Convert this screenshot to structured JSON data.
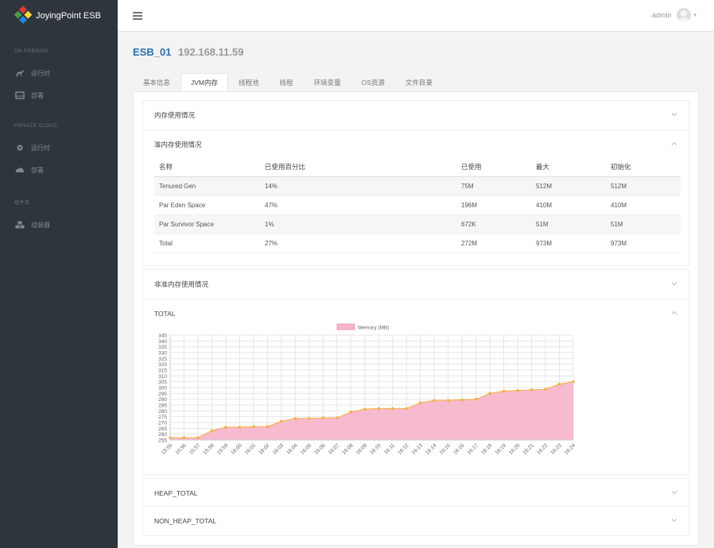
{
  "app": {
    "name": "JoyingPoint ESB"
  },
  "sidebar": {
    "sections": [
      {
        "title": "ON PREMISE",
        "items": [
          {
            "label": "运行时"
          },
          {
            "label": "部署"
          }
        ]
      },
      {
        "title": "PRIVATE CLOUD",
        "items": [
          {
            "label": "运行时"
          },
          {
            "label": "部署"
          }
        ]
      },
      {
        "title": "组件库",
        "items": [
          {
            "label": "组装器"
          }
        ]
      }
    ]
  },
  "header": {
    "user": "admin"
  },
  "page": {
    "name": "ESB_01",
    "ip": "192.168.11.59"
  },
  "tabs": [
    {
      "label": "基本信息"
    },
    {
      "label": "JVM内存"
    },
    {
      "label": "线程池"
    },
    {
      "label": "线程"
    },
    {
      "label": "环境变量"
    },
    {
      "label": "OS资源"
    },
    {
      "label": "文件目录"
    }
  ],
  "panels": {
    "memory_usage": {
      "title": "内存使用情况"
    },
    "heap": {
      "title": "准内存使用情况",
      "columns": [
        "名称",
        "已使用百分比",
        "已使用",
        "最大",
        "初始化"
      ],
      "rows": [
        [
          "Tenured Gen",
          "14%",
          "75M",
          "512M",
          "512M"
        ],
        [
          "Par Eden Space",
          "47%",
          "196M",
          "410M",
          "410M"
        ],
        [
          "Par Survivor Space",
          "1%",
          "672K",
          "51M",
          "51M"
        ],
        [
          "Total",
          "27%",
          "272M",
          "973M",
          "973M"
        ]
      ]
    },
    "nonheap": {
      "title": "非准内存使用情况"
    },
    "total": {
      "title": "TOTAL"
    },
    "heap_total": {
      "title": "HEAP_TOTAL"
    },
    "non_heap_total": {
      "title": "NON_HEAP_TOTAL"
    }
  },
  "chart_data": {
    "type": "area",
    "legend": "Memory (MB)",
    "legend_position": "top-center",
    "grid": true,
    "ylim": [
      255,
      345
    ],
    "yticks": [
      255,
      260,
      265,
      270,
      275,
      280,
      285,
      290,
      295,
      300,
      305,
      310,
      315,
      320,
      325,
      330,
      335,
      340,
      345
    ],
    "x": [
      "15:55",
      "15:56",
      "15:57",
      "15:58",
      "15:59",
      "16:00",
      "16:01",
      "16:02",
      "16:03",
      "16:04",
      "16:05",
      "16:06",
      "16:07",
      "16:08",
      "16:09",
      "16:10",
      "16:11",
      "16:12",
      "16:13",
      "16:14",
      "16:15",
      "16:16",
      "16:17",
      "16:18",
      "16:19",
      "16:20",
      "16:21",
      "16:22",
      "16:23",
      "16:24"
    ],
    "series": [
      {
        "name": "Memory (MB)",
        "values": [
          257,
          257,
          257,
          263,
          266,
          266,
          266.5,
          266.5,
          271,
          273.5,
          273.5,
          274,
          274,
          279,
          281.5,
          282,
          282,
          282,
          287,
          289,
          289,
          289.5,
          290,
          295,
          297,
          297.5,
          298,
          298.5,
          303,
          305
        ],
        "fill": "#f7b6cb",
        "line": "#f5b041"
      }
    ]
  },
  "colors": {
    "sidebar": "#2f353d",
    "accent": "#2a6fb0",
    "area_fill": "#f7b6cb",
    "area_line": "#f5b041"
  }
}
